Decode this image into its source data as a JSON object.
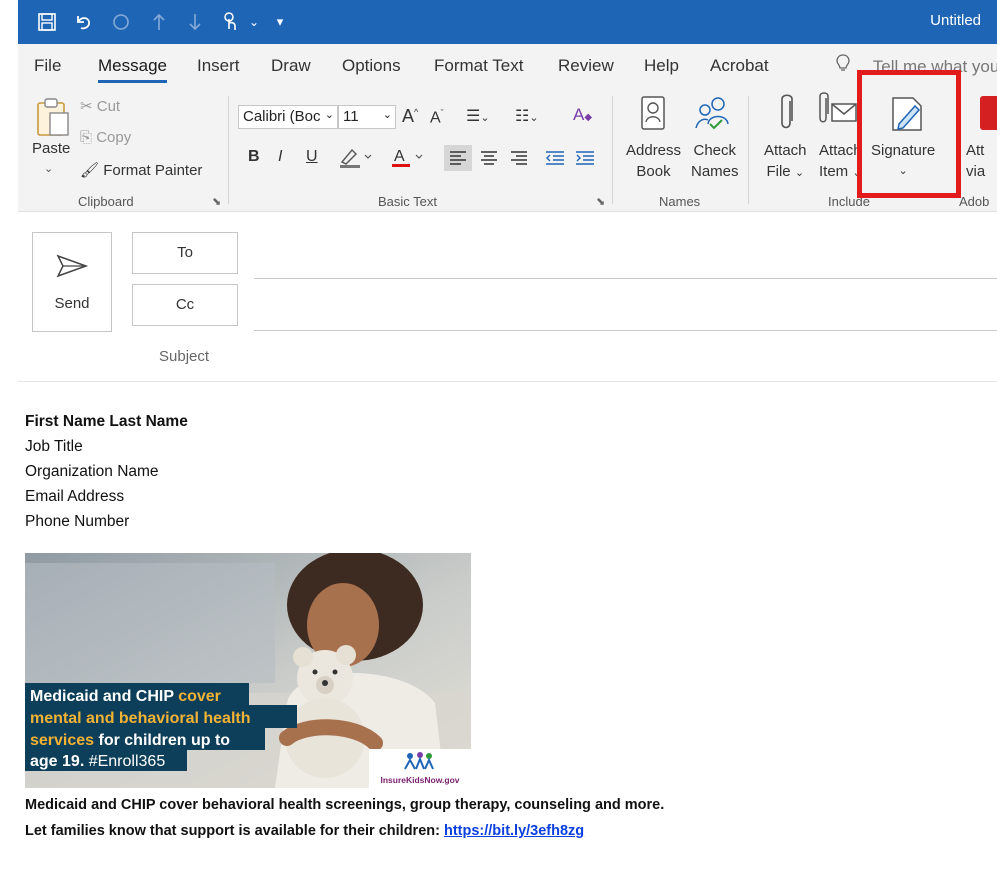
{
  "window": {
    "title": "Untitled"
  },
  "tabs": [
    "File",
    "Message",
    "Insert",
    "Draw",
    "Options",
    "Format Text",
    "Review",
    "Help",
    "Acrobat"
  ],
  "active_tab": "Message",
  "tell_me": "Tell me what you",
  "clipboard": {
    "paste": "Paste",
    "cut": "Cut",
    "copy": "Copy",
    "format_painter": "Format Painter",
    "group": "Clipboard"
  },
  "basic_text": {
    "font_name": "Calibri (Boc",
    "font_size": "11",
    "bold": "B",
    "italic": "I",
    "underline": "U",
    "group": "Basic Text"
  },
  "names": {
    "address_book_1": "Address",
    "address_book_2": "Book",
    "check_names_1": "Check",
    "check_names_2": "Names",
    "group": "Names"
  },
  "include": {
    "attach_file_1": "Attach",
    "attach_file_2": "File",
    "attach_item_1": "Attach",
    "attach_item_2": "Item",
    "signature": "Signature",
    "group": "Include"
  },
  "adobe": {
    "label_1": "Att",
    "label_2": "via",
    "group": "Adob"
  },
  "compose": {
    "send": "Send",
    "to": "To",
    "cc": "Cc",
    "subject": "Subject"
  },
  "signature": {
    "name": "First Name Last Name",
    "job_title": "Job Title",
    "organization": "Organization Name",
    "email": "Email Address",
    "phone": "Phone Number"
  },
  "banner": {
    "line1_white": "Medicaid and CHIP ",
    "line1_gold": "cover",
    "line2_gold": "mental and behavioral health",
    "line3_gold": "services",
    "line3_white": " for children up to",
    "line4": "age 19.",
    "line4_tag": " #Enroll365",
    "logo_text": "InsureKidsNow.gov"
  },
  "caption": {
    "line1": "Medicaid and CHIP cover behavioral health screenings, group therapy, counseling and more.",
    "line2": "Let families know that support is available for their children: ",
    "link": "https://bit.ly/3efh8zg"
  },
  "colors": {
    "title_bar": "#1f65b6",
    "highlight": "#e21b1b",
    "banner_gold": "#f2b233",
    "banner_navy": "#0e3f5a",
    "link": "#0b3fe0"
  }
}
